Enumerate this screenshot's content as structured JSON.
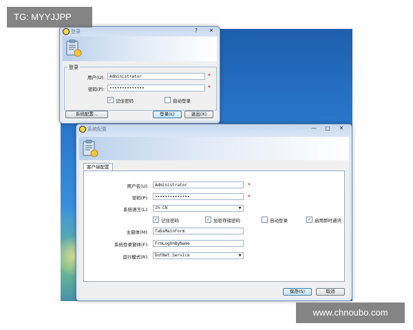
{
  "watermarks": {
    "top_left": "TG: MYYJJPP",
    "bottom_right": "www.chnoubo.com"
  },
  "login_window": {
    "title": "登录",
    "help_btn": "?",
    "close_btn": "✕",
    "group_title": "登录",
    "username_label": "用户(U):",
    "username_value": "Administrator",
    "password_label": "密码(P):",
    "password_value": "••••••••••••••",
    "remember_password": {
      "label": "记住密码",
      "checked": true
    },
    "auto_login": {
      "label": "自动登录",
      "checked": false
    },
    "settings_button": "系统配置...",
    "login_button": "登录(L)",
    "exit_button": "退出(X)",
    "required_mark": "*"
  },
  "settings_window": {
    "title": "系统配置",
    "minimize_btn": "—",
    "maximize_btn": "□",
    "close_btn": "✕",
    "tab_label": "客户端配置",
    "username_label": "用户名(U):",
    "username_value": "Administrator",
    "password_label": "密码(P):",
    "password_value": "••••••••••••••",
    "language_label": "系统语言(L):",
    "language_value": "zh-CN",
    "remember_password": {
      "label": "记住密码",
      "checked": true
    },
    "encrypt_password": {
      "label": "加密存储密码",
      "checked": true
    },
    "auto_login": {
      "label": "自动登录",
      "checked": false
    },
    "instant_comm": {
      "label": "启用即时通讯",
      "checked": true
    },
    "main_form_label": "主窗体(M):",
    "main_form_value": "TabsMainForm",
    "login_form_label": "系统登录窗体(F):",
    "login_form_value": "FrmLogOnByName",
    "run_mode_label": "运行模式(R):",
    "run_mode_value": "DotNet.Service",
    "save_button": "保存(S)",
    "cancel_button": "取消",
    "required_mark": "*"
  },
  "colors": {
    "desktop": "#2a7ad0",
    "accent": "#3c7fb1",
    "required": "#cc0000"
  }
}
